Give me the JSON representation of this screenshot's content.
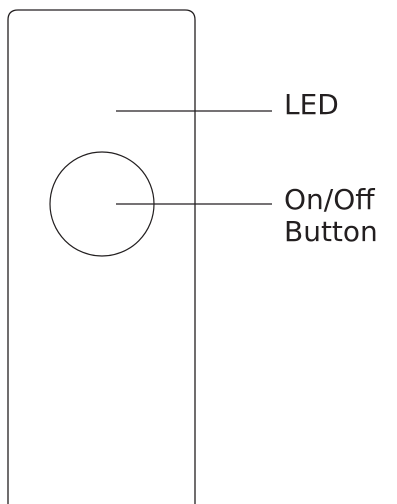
{
  "labels": {
    "led": "LED",
    "button_line1": "On/Off",
    "button_line2": "Button"
  },
  "colors": {
    "stroke": "#231f20",
    "background": "#ffffff"
  }
}
